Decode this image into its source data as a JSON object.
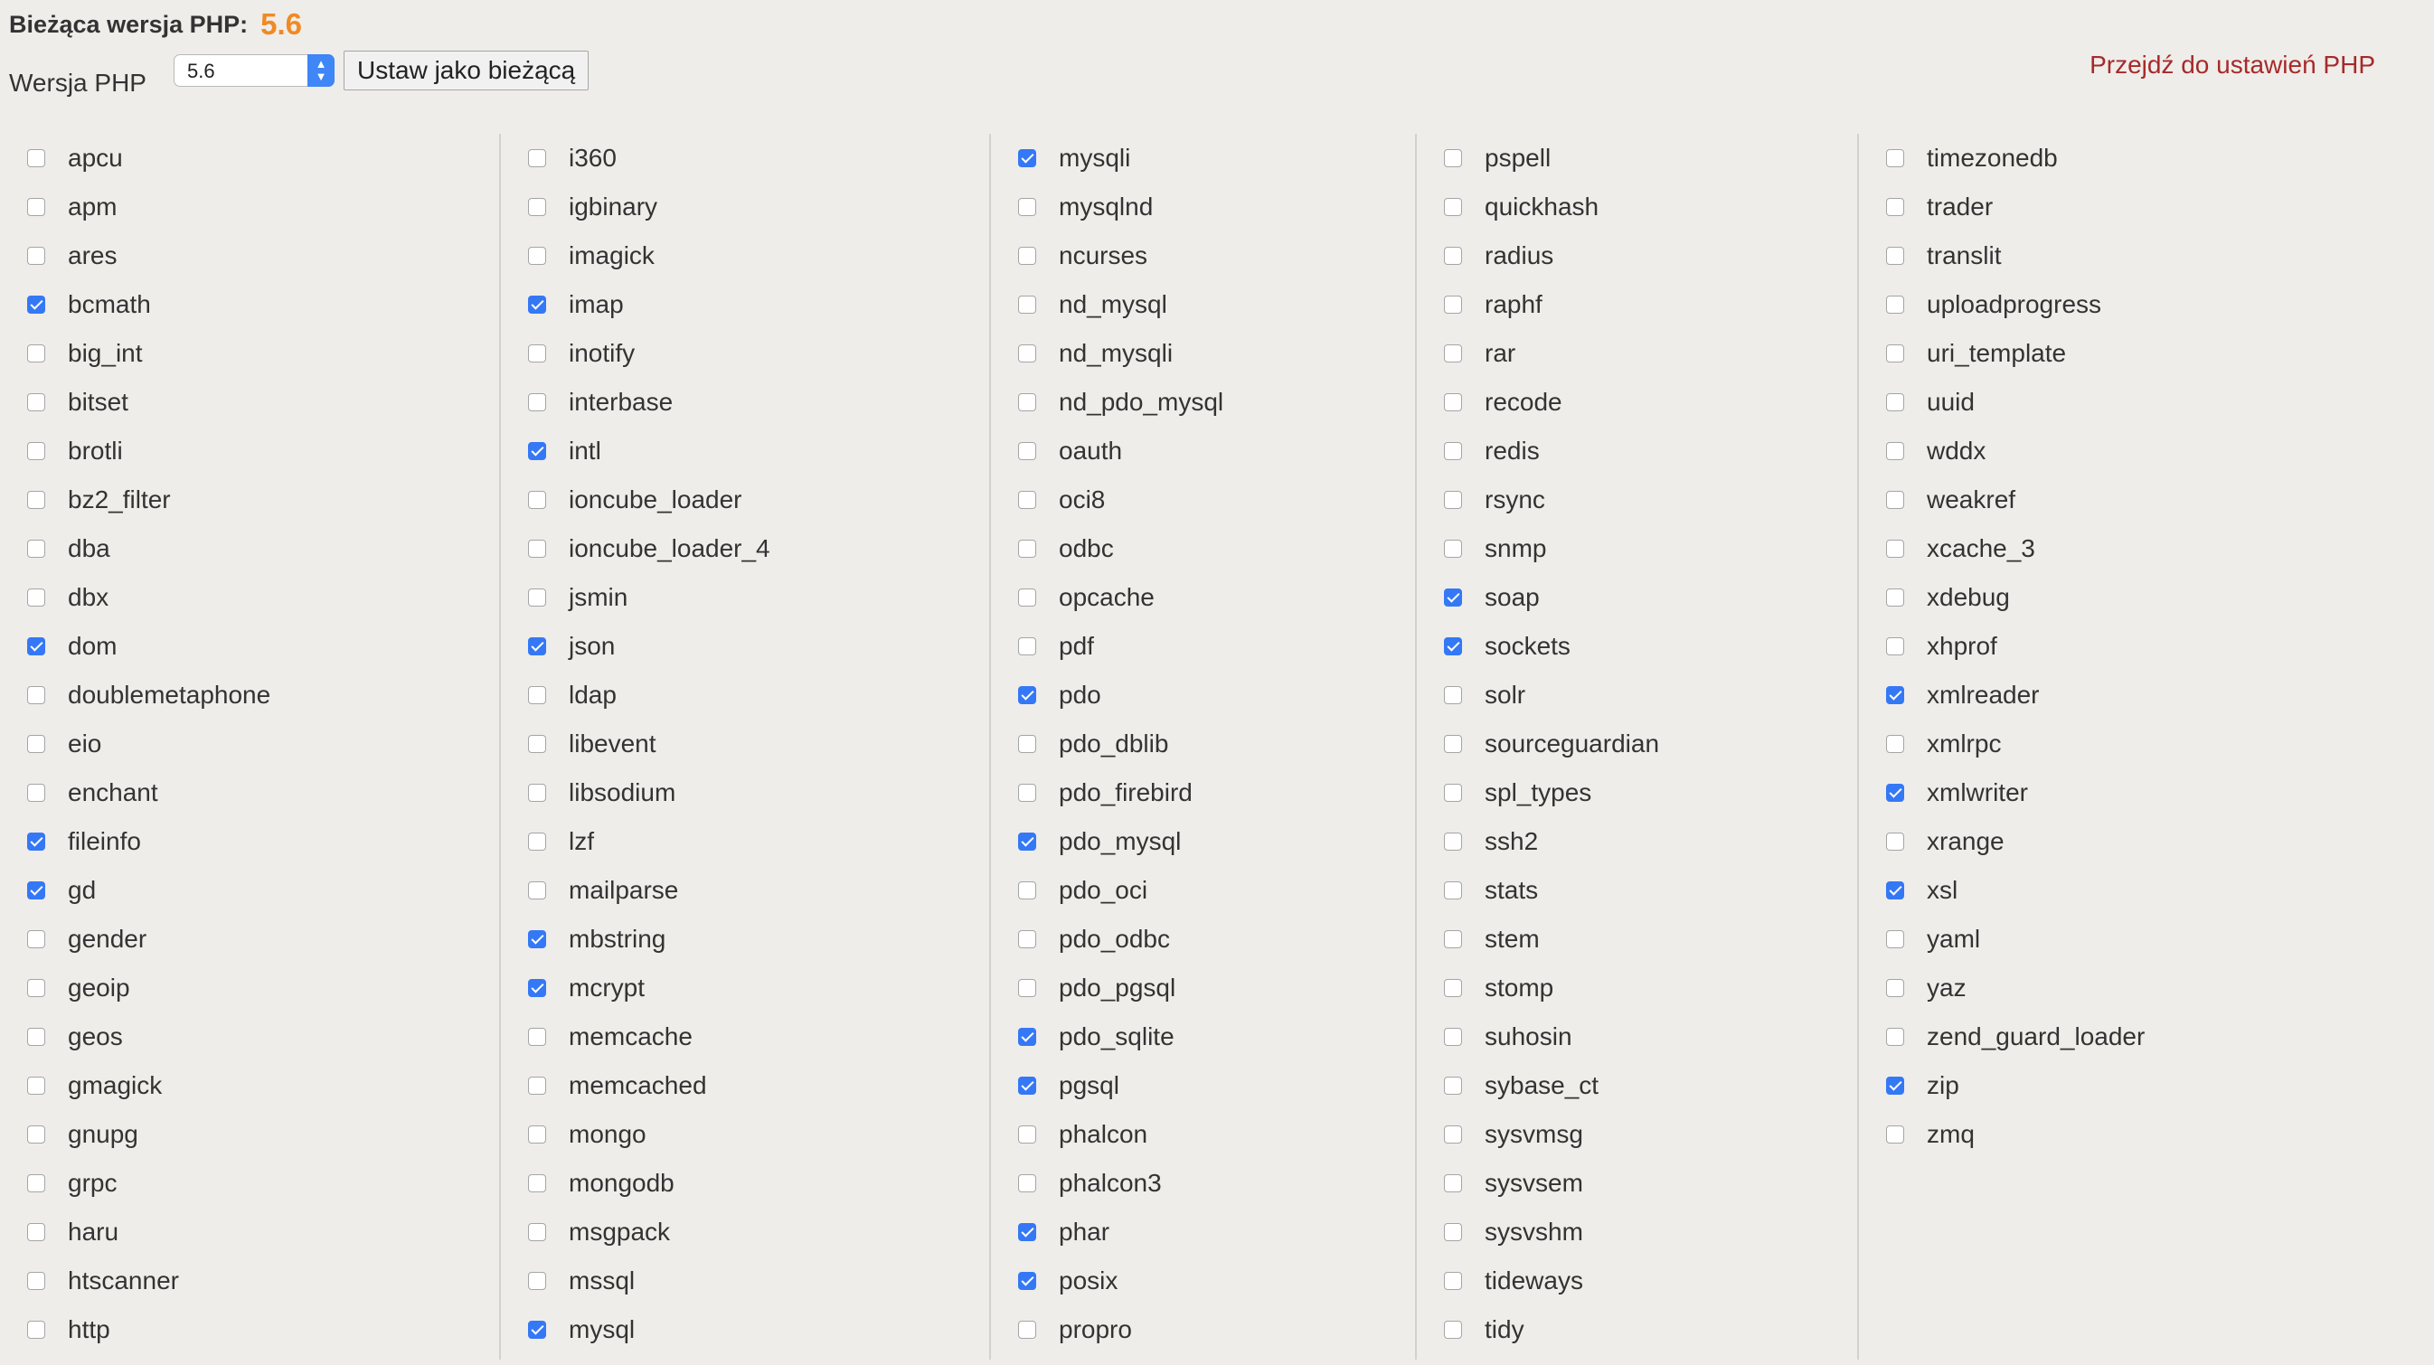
{
  "header": {
    "current_label": "Bieżąca wersja PHP:",
    "current_value": "5.6",
    "version_label": "Wersja PHP",
    "selected_version": "5.6",
    "set_current_button": "Ustaw jako bieżącą",
    "settings_link": "Przejdź do ustawień PHP"
  },
  "colors": {
    "background": "#efedea",
    "current_version": "#f08a24",
    "link": "#a62a2a",
    "checkbox_checked": "#3478f6",
    "column_divider": "#d3d1ce"
  },
  "columns": [
    [
      {
        "name": "apcu",
        "checked": false
      },
      {
        "name": "apm",
        "checked": false
      },
      {
        "name": "ares",
        "checked": false
      },
      {
        "name": "bcmath",
        "checked": true
      },
      {
        "name": "big_int",
        "checked": false
      },
      {
        "name": "bitset",
        "checked": false
      },
      {
        "name": "brotli",
        "checked": false
      },
      {
        "name": "bz2_filter",
        "checked": false
      },
      {
        "name": "dba",
        "checked": false
      },
      {
        "name": "dbx",
        "checked": false
      },
      {
        "name": "dom",
        "checked": true
      },
      {
        "name": "doublemetaphone",
        "checked": false
      },
      {
        "name": "eio",
        "checked": false
      },
      {
        "name": "enchant",
        "checked": false
      },
      {
        "name": "fileinfo",
        "checked": true
      },
      {
        "name": "gd",
        "checked": true
      },
      {
        "name": "gender",
        "checked": false
      },
      {
        "name": "geoip",
        "checked": false
      },
      {
        "name": "geos",
        "checked": false
      },
      {
        "name": "gmagick",
        "checked": false
      },
      {
        "name": "gnupg",
        "checked": false
      },
      {
        "name": "grpc",
        "checked": false
      },
      {
        "name": "haru",
        "checked": false
      },
      {
        "name": "htscanner",
        "checked": false
      },
      {
        "name": "http",
        "checked": false
      }
    ],
    [
      {
        "name": "i360",
        "checked": false
      },
      {
        "name": "igbinary",
        "checked": false
      },
      {
        "name": "imagick",
        "checked": false
      },
      {
        "name": "imap",
        "checked": true
      },
      {
        "name": "inotify",
        "checked": false
      },
      {
        "name": "interbase",
        "checked": false
      },
      {
        "name": "intl",
        "checked": true
      },
      {
        "name": "ioncube_loader",
        "checked": false
      },
      {
        "name": "ioncube_loader_4",
        "checked": false
      },
      {
        "name": "jsmin",
        "checked": false
      },
      {
        "name": "json",
        "checked": true
      },
      {
        "name": "ldap",
        "checked": false
      },
      {
        "name": "libevent",
        "checked": false
      },
      {
        "name": "libsodium",
        "checked": false
      },
      {
        "name": "lzf",
        "checked": false
      },
      {
        "name": "mailparse",
        "checked": false
      },
      {
        "name": "mbstring",
        "checked": true
      },
      {
        "name": "mcrypt",
        "checked": true
      },
      {
        "name": "memcache",
        "checked": false
      },
      {
        "name": "memcached",
        "checked": false
      },
      {
        "name": "mongo",
        "checked": false
      },
      {
        "name": "mongodb",
        "checked": false
      },
      {
        "name": "msgpack",
        "checked": false
      },
      {
        "name": "mssql",
        "checked": false
      },
      {
        "name": "mysql",
        "checked": true
      }
    ],
    [
      {
        "name": "mysqli",
        "checked": true
      },
      {
        "name": "mysqlnd",
        "checked": false
      },
      {
        "name": "ncurses",
        "checked": false
      },
      {
        "name": "nd_mysql",
        "checked": false
      },
      {
        "name": "nd_mysqli",
        "checked": false
      },
      {
        "name": "nd_pdo_mysql",
        "checked": false
      },
      {
        "name": "oauth",
        "checked": false
      },
      {
        "name": "oci8",
        "checked": false
      },
      {
        "name": "odbc",
        "checked": false
      },
      {
        "name": "opcache",
        "checked": false
      },
      {
        "name": "pdf",
        "checked": false
      },
      {
        "name": "pdo",
        "checked": true
      },
      {
        "name": "pdo_dblib",
        "checked": false
      },
      {
        "name": "pdo_firebird",
        "checked": false
      },
      {
        "name": "pdo_mysql",
        "checked": true
      },
      {
        "name": "pdo_oci",
        "checked": false
      },
      {
        "name": "pdo_odbc",
        "checked": false
      },
      {
        "name": "pdo_pgsql",
        "checked": false
      },
      {
        "name": "pdo_sqlite",
        "checked": true
      },
      {
        "name": "pgsql",
        "checked": true
      },
      {
        "name": "phalcon",
        "checked": false
      },
      {
        "name": "phalcon3",
        "checked": false
      },
      {
        "name": "phar",
        "checked": true
      },
      {
        "name": "posix",
        "checked": true
      },
      {
        "name": "propro",
        "checked": false
      }
    ],
    [
      {
        "name": "pspell",
        "checked": false
      },
      {
        "name": "quickhash",
        "checked": false
      },
      {
        "name": "radius",
        "checked": false
      },
      {
        "name": "raphf",
        "checked": false
      },
      {
        "name": "rar",
        "checked": false
      },
      {
        "name": "recode",
        "checked": false
      },
      {
        "name": "redis",
        "checked": false
      },
      {
        "name": "rsync",
        "checked": false
      },
      {
        "name": "snmp",
        "checked": false
      },
      {
        "name": "soap",
        "checked": true
      },
      {
        "name": "sockets",
        "checked": true
      },
      {
        "name": "solr",
        "checked": false
      },
      {
        "name": "sourceguardian",
        "checked": false
      },
      {
        "name": "spl_types",
        "checked": false
      },
      {
        "name": "ssh2",
        "checked": false
      },
      {
        "name": "stats",
        "checked": false
      },
      {
        "name": "stem",
        "checked": false
      },
      {
        "name": "stomp",
        "checked": false
      },
      {
        "name": "suhosin",
        "checked": false
      },
      {
        "name": "sybase_ct",
        "checked": false
      },
      {
        "name": "sysvmsg",
        "checked": false
      },
      {
        "name": "sysvsem",
        "checked": false
      },
      {
        "name": "sysvshm",
        "checked": false
      },
      {
        "name": "tideways",
        "checked": false
      },
      {
        "name": "tidy",
        "checked": false
      }
    ],
    [
      {
        "name": "timezonedb",
        "checked": false
      },
      {
        "name": "trader",
        "checked": false
      },
      {
        "name": "translit",
        "checked": false
      },
      {
        "name": "uploadprogress",
        "checked": false
      },
      {
        "name": "uri_template",
        "checked": false
      },
      {
        "name": "uuid",
        "checked": false
      },
      {
        "name": "wddx",
        "checked": false
      },
      {
        "name": "weakref",
        "checked": false
      },
      {
        "name": "xcache_3",
        "checked": false
      },
      {
        "name": "xdebug",
        "checked": false
      },
      {
        "name": "xhprof",
        "checked": false
      },
      {
        "name": "xmlreader",
        "checked": true
      },
      {
        "name": "xmlrpc",
        "checked": false
      },
      {
        "name": "xmlwriter",
        "checked": true
      },
      {
        "name": "xrange",
        "checked": false
      },
      {
        "name": "xsl",
        "checked": true
      },
      {
        "name": "yaml",
        "checked": false
      },
      {
        "name": "yaz",
        "checked": false
      },
      {
        "name": "zend_guard_loader",
        "checked": false
      },
      {
        "name": "zip",
        "checked": true
      },
      {
        "name": "zmq",
        "checked": false
      }
    ]
  ]
}
